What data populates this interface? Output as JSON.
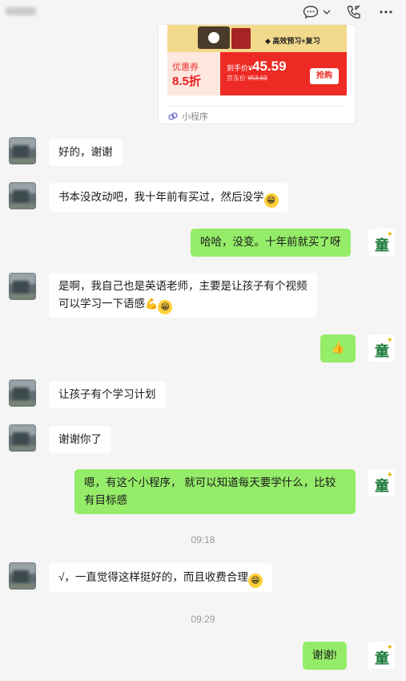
{
  "header": {
    "icons": [
      "chat-icon",
      "chevron-down-icon",
      "phone-icon",
      "more-icon"
    ]
  },
  "mini_program": {
    "banner_tag": "◆ 高效预习+复习",
    "coupon_label": "优惠券",
    "coupon_value": "8.5折",
    "price_label": "到手价¥",
    "price": "45.59",
    "jd_price_label": "京东价",
    "jd_price": "¥53.63",
    "buy_label": "抢购",
    "footer_label": "小程序"
  },
  "messages": [
    {
      "side": "left",
      "text": "好的，谢谢"
    },
    {
      "side": "left",
      "text": "书本没改动吧，我十年前有买过，然后没学"
    },
    {
      "side": "right",
      "text": "哈哈，没变。十年前就买了呀"
    },
    {
      "side": "left",
      "line1": "是啊，我自己也是英语老师，主要是让孩子有个视频",
      "line2": "可以学习一下语感"
    },
    {
      "side": "right",
      "text": "👍"
    },
    {
      "side": "left",
      "text": "让孩子有个学习计划"
    },
    {
      "side": "left",
      "text": "谢谢你了"
    },
    {
      "side": "right",
      "line1": "嗯，有这个小程序， 就可以知道每天要学什么，比较",
      "line2": "有目标感"
    },
    {
      "side": "left",
      "text": "√，一直觉得这样挺好的，而且收费合理"
    },
    {
      "side": "right",
      "text": "谢谢!"
    }
  ],
  "timestamps": [
    "09:18",
    "09:29"
  ],
  "my_avatar_text": "童",
  "colors": {
    "right_bubble": "#95ec69",
    "left_bubble": "#ffffff",
    "background": "#f5f5f5",
    "accent_red": "#ee2a24"
  }
}
